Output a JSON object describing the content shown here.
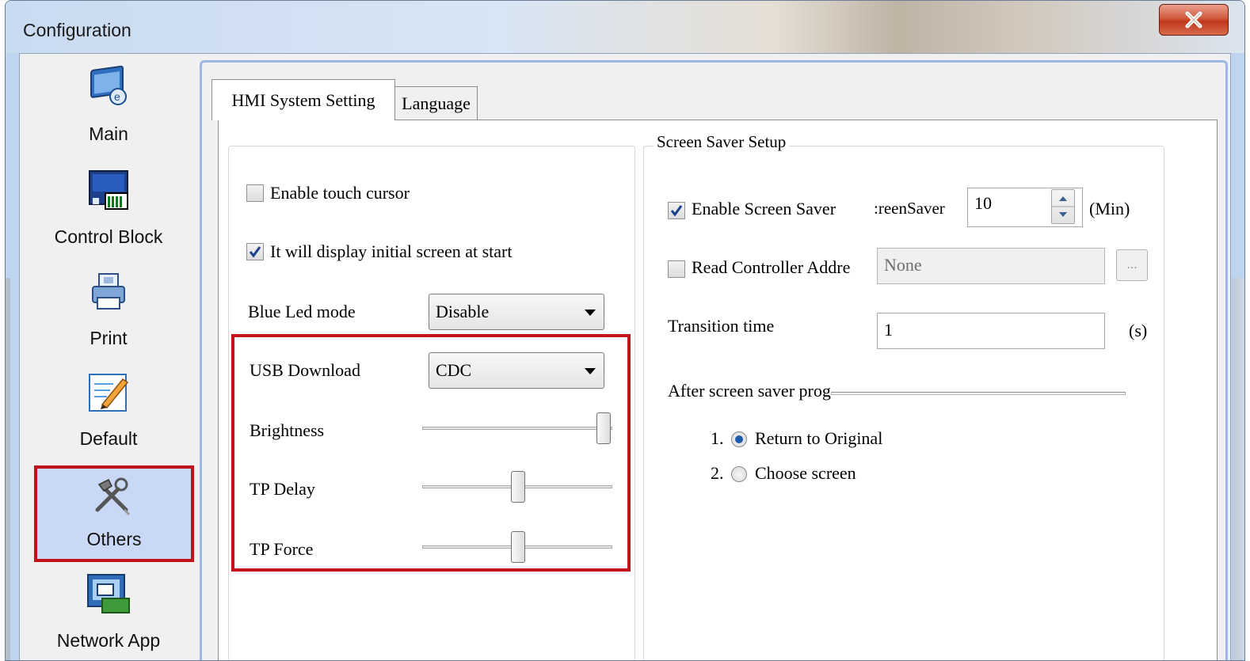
{
  "window": {
    "title": "Configuration",
    "close_icon": "close-icon"
  },
  "sidebar": {
    "items": [
      {
        "label": "Main",
        "icon": "main-config-icon"
      },
      {
        "label": "Control Block",
        "icon": "control-block-icon"
      },
      {
        "label": "Print",
        "icon": "printer-icon"
      },
      {
        "label": "Default",
        "icon": "default-edit-icon"
      },
      {
        "label": "Others",
        "icon": "tools-icon",
        "selected": true
      },
      {
        "label": "Network App",
        "icon": "network-app-icon"
      }
    ]
  },
  "tabs": [
    {
      "label": "HMI System Setting",
      "active": true
    },
    {
      "label": "Language",
      "active": false
    }
  ],
  "left_group": {
    "enable_touch_cursor": {
      "label": "Enable touch cursor",
      "checked": false
    },
    "display_initial": {
      "label": "It will display initial screen at start",
      "checked": true
    },
    "blue_led": {
      "label": "Blue Led mode",
      "value": "Disable"
    },
    "usb_download": {
      "label": "USB Download",
      "value": "CDC"
    },
    "brightness": {
      "label": "Brightness",
      "level": 1.0
    },
    "tp_delay": {
      "label": "TP Delay",
      "level": 0.5
    },
    "tp_force": {
      "label": "TP Force",
      "level": 0.5
    }
  },
  "screen_saver": {
    "title": "Screen Saver Setup",
    "enable": {
      "label": "Enable Screen Saver",
      "checked": true
    },
    "timeout_label": ":reenSaver",
    "timeout_value": "10",
    "timeout_unit": "(Min)",
    "read_controller": {
      "label": "Read Controller Addre",
      "checked": false
    },
    "address_value": "None",
    "browse_label": "...",
    "transition_label": "Transition time",
    "transition_value": "1",
    "transition_unit": "(s)",
    "after_label": "After screen saver prog",
    "options": [
      {
        "number": "1.",
        "label": "Return to Original",
        "selected": true
      },
      {
        "number": "2.",
        "label": "Choose screen",
        "selected": false
      }
    ]
  },
  "colors": {
    "highlight": "#c0131b",
    "selected_bg": "#c9d9f5"
  }
}
